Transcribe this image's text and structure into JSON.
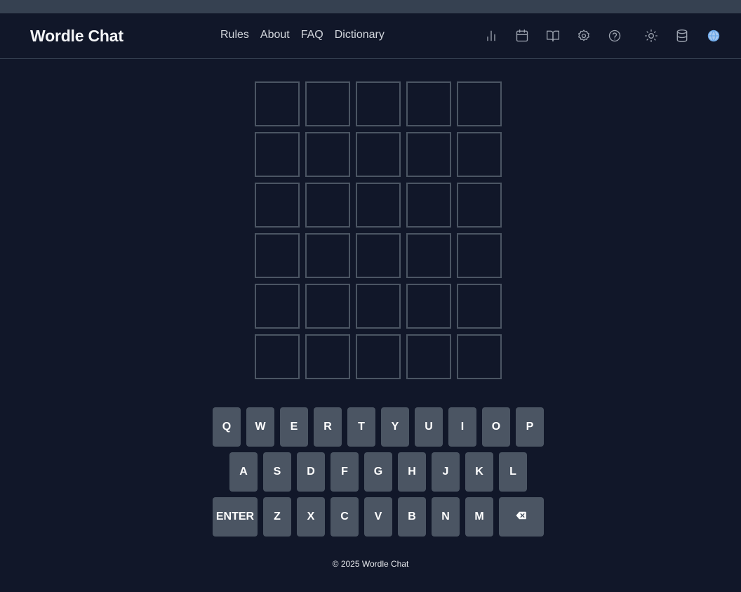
{
  "header": {
    "brand": "Wordle Chat",
    "nav": [
      "Rules",
      "About",
      "FAQ",
      "Dictionary"
    ],
    "icons": [
      "bar-chart-icon",
      "calendar-icon",
      "book-open-icon",
      "gear-icon",
      "help-circle-icon",
      "sun-icon",
      "database-icon",
      "globe-icon"
    ]
  },
  "board": {
    "rows": 6,
    "cols": 5
  },
  "keyboard": {
    "row1": [
      "Q",
      "W",
      "E",
      "R",
      "T",
      "Y",
      "U",
      "I",
      "O",
      "P"
    ],
    "row2": [
      "A",
      "S",
      "D",
      "F",
      "G",
      "H",
      "J",
      "K",
      "L"
    ],
    "row3": [
      "ENTER",
      "Z",
      "X",
      "C",
      "V",
      "B",
      "N",
      "M",
      "⌫"
    ]
  },
  "footer": {
    "text": "© 2025 Wordle Chat"
  },
  "colors": {
    "background": "#111729",
    "tile_border": "#4b5563",
    "key_bg": "#4b5563"
  }
}
